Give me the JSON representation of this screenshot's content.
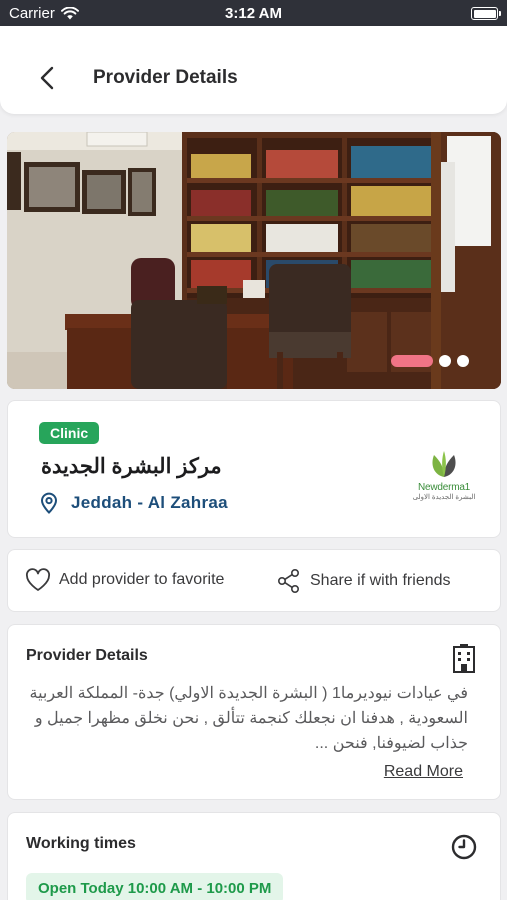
{
  "status": {
    "carrier": "Carrier",
    "time": "3:12 AM"
  },
  "header": {
    "title": "Provider Details"
  },
  "gallery": {
    "slide_count": 3,
    "active_index": 0
  },
  "provider": {
    "type_badge": "Clinic",
    "name": "مركز البشرة الجديدة",
    "location": "Jeddah - Al Zahraa",
    "logo": {
      "brand": "Newderma1",
      "brand_ar": "البشرة الجديدة الاولى"
    }
  },
  "actions": {
    "favorite_label": "Add provider to favorite",
    "share_label": "Share if with friends"
  },
  "details": {
    "title": "Provider Details",
    "description": "في عيادات نيوديرما1 ( البشرة الجديدة الاولي)  جدة- المملكة العربية السعودية , هدفنا ان نجعلك كنجمة تتألق , نحن نخلق مظهرا جميل و جذاب لضيوفنا, فنحن  ...",
    "read_more": "Read More"
  },
  "working_times": {
    "title": "Working times",
    "status": "Open Today 10:00 AM - 10:00 PM"
  },
  "colors": {
    "accent_green": "#27a55b",
    "location_blue": "#1d4e7a",
    "active_dot": "#f07486"
  }
}
